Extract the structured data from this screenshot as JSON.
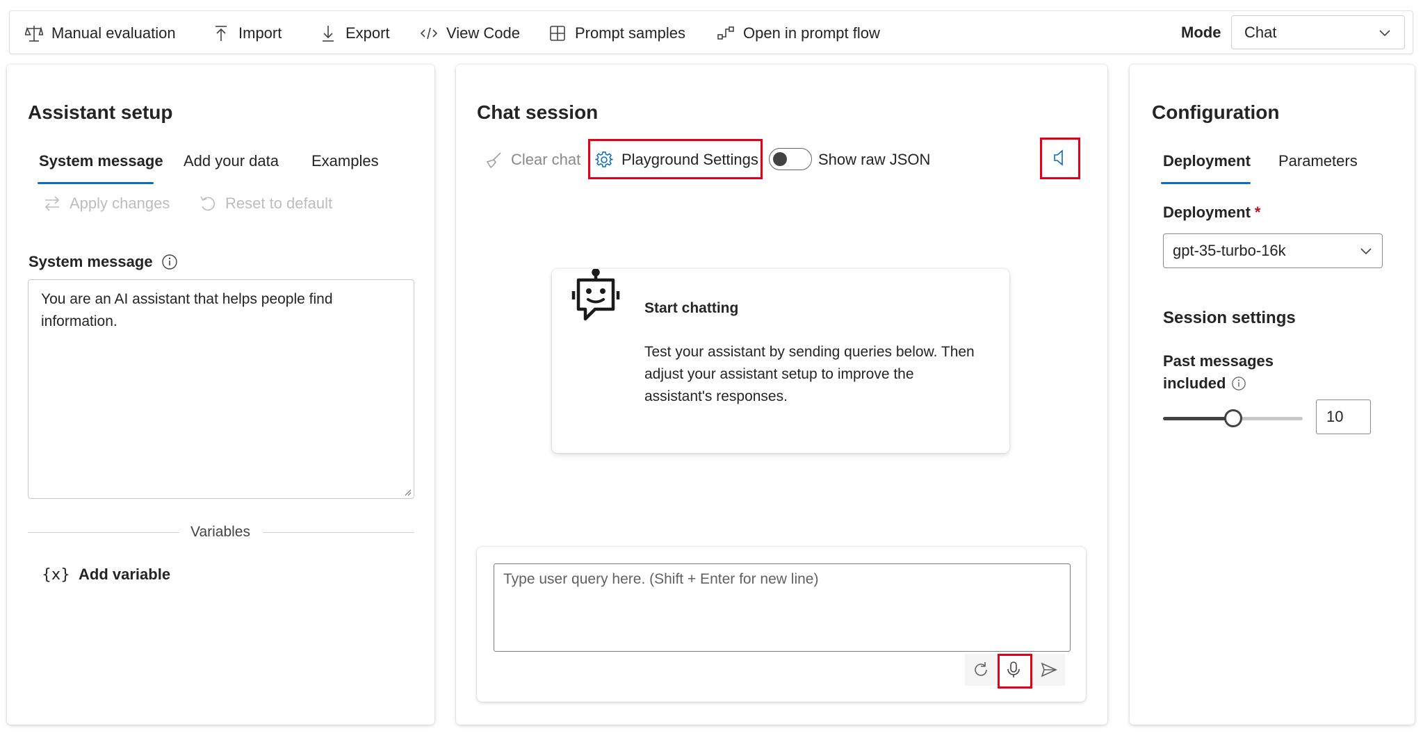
{
  "toolbar": {
    "manual_evaluation": "Manual evaluation",
    "import": "Import",
    "export": "Export",
    "view_code": "View Code",
    "prompt_samples": "Prompt samples",
    "open_in_prompt_flow": "Open in prompt flow",
    "mode_label": "Mode",
    "mode_value": "Chat"
  },
  "assistant_setup": {
    "title": "Assistant setup",
    "tabs": [
      "System message",
      "Add your data",
      "Examples"
    ],
    "active_tab": "System message",
    "apply_changes": "Apply changes",
    "reset_to_default": "Reset to default",
    "system_message_label": "System message",
    "system_message_value": "You are an AI assistant that helps people find information.",
    "variables_label": "Variables",
    "add_variable": "Add variable",
    "add_variable_glyph": "{x}"
  },
  "chat_session": {
    "title": "Chat session",
    "clear_chat": "Clear chat",
    "playground_settings": "Playground Settings",
    "show_raw_json": "Show raw JSON",
    "show_raw_json_on": false,
    "start_title": "Start chatting",
    "start_body": "Test your assistant by sending queries below. Then adjust your assistant setup to improve the assistant's responses.",
    "query_placeholder": "Type user query here. (Shift + Enter for new line)"
  },
  "configuration": {
    "title": "Configuration",
    "tabs": [
      "Deployment",
      "Parameters"
    ],
    "active_tab": "Deployment",
    "deployment_label": "Deployment",
    "required_marker": "*",
    "deployment_value": "gpt-35-turbo-16k",
    "session_settings_title": "Session settings",
    "past_messages_label_line1": "Past messages",
    "past_messages_label_line2": "included",
    "past_messages_value": "10",
    "past_messages_slider_fraction": 0.5
  },
  "colors": {
    "accent": "#0f6cbd",
    "highlight": "#e3001b",
    "disabled_text": "#bdbdbd",
    "required": "#c50f1f"
  },
  "icons": [
    "scales-icon",
    "upload-icon",
    "download-icon",
    "code-icon",
    "grid-icon",
    "flow-icon",
    "chevron-down-icon",
    "swap-icon",
    "undo-icon",
    "info-icon",
    "broom-icon",
    "gear-icon",
    "speaker-icon",
    "bot-icon",
    "refresh-icon",
    "microphone-icon",
    "send-icon",
    "variable-icon"
  ]
}
